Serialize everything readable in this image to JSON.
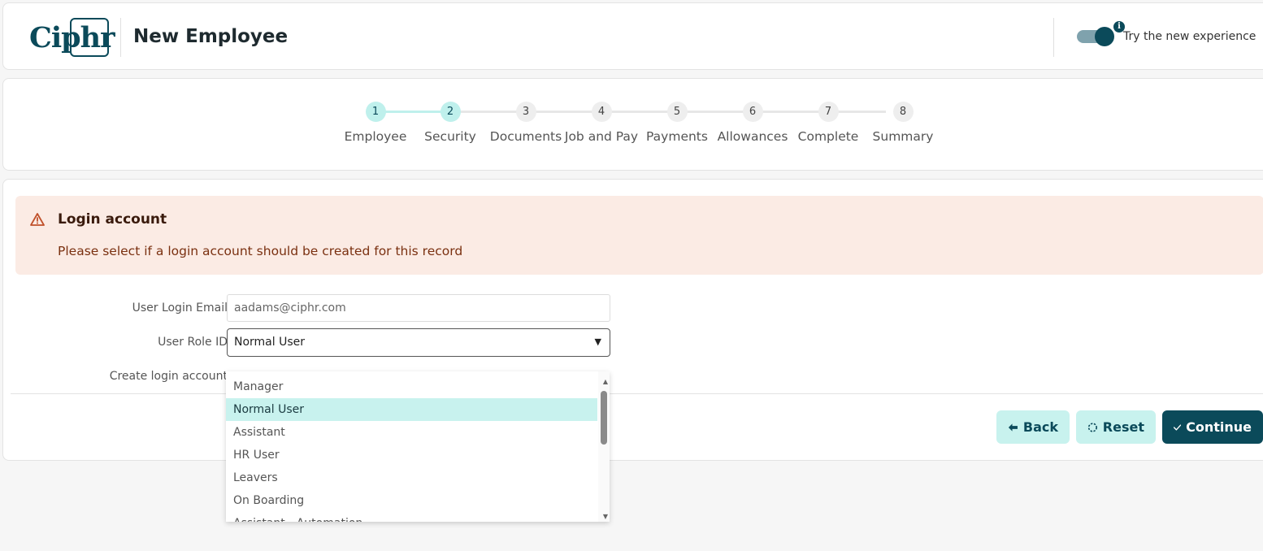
{
  "header": {
    "logo_text": "Ciphr",
    "title": "New Employee",
    "toggle_label": "Try the new experience",
    "info_glyph": "i"
  },
  "stepper": {
    "steps": [
      {
        "number": "1",
        "label": "Employee",
        "active": true
      },
      {
        "number": "2",
        "label": "Security",
        "active": true
      },
      {
        "number": "3",
        "label": "Documents",
        "active": false
      },
      {
        "number": "4",
        "label": "Job and Pay",
        "active": false
      },
      {
        "number": "5",
        "label": "Payments",
        "active": false
      },
      {
        "number": "6",
        "label": "Allowances",
        "active": false
      },
      {
        "number": "7",
        "label": "Complete",
        "active": false
      },
      {
        "number": "8",
        "label": "Summary",
        "active": false
      }
    ]
  },
  "alert": {
    "title": "Login account",
    "message": "Please select if a login account should be created for this record",
    "icon": "warning-triangle-icon"
  },
  "form": {
    "email_label": "User Login Email",
    "email_value": "aadams@ciphr.com",
    "role_label": "User Role ID",
    "role_value": "Normal User",
    "create_login_label": "Create login account"
  },
  "dropdown": {
    "options": [
      "Manager",
      "Normal User",
      "Assistant",
      "HR User",
      "Leavers",
      "On Boarding",
      "Assistant - Automation"
    ],
    "selected": "Normal User"
  },
  "buttons": {
    "back": "Back",
    "reset": "Reset",
    "continue": "Continue"
  },
  "colors": {
    "brand": "#0b4a5a",
    "accent_light": "#c8f2ee",
    "alert_bg": "#fbebe4",
    "alert_icon": "#c0502a"
  }
}
